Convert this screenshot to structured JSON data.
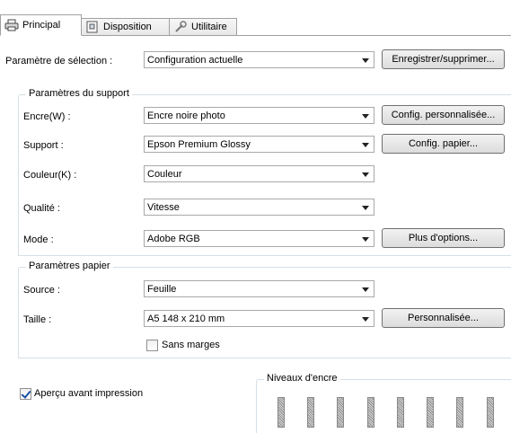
{
  "tabs": [
    {
      "label": "Principal",
      "icon": "printer-icon",
      "active": true
    },
    {
      "label": "Disposition",
      "icon": "page-layout-icon",
      "active": false
    },
    {
      "label": "Utilitaire",
      "icon": "wrench-icon",
      "active": false
    }
  ],
  "selection": {
    "label": "Paramètre de sélection :",
    "value": "Configuration actuelle",
    "button": "Enregistrer/supprimer..."
  },
  "support": {
    "title": "Paramètres du support",
    "encre": {
      "label": "Encre(W) :",
      "value": "Encre noire photo",
      "button": "Config. personnalisée..."
    },
    "support": {
      "label": "Support :",
      "value": "Epson Premium Glossy",
      "button": "Config. papier..."
    },
    "couleur": {
      "label": "Couleur(K) :",
      "value": "Couleur"
    },
    "qualite": {
      "label": "Qualité :",
      "value": "Vitesse"
    },
    "mode": {
      "label": "Mode :",
      "value": "Adobe RGB",
      "button": "Plus d'options..."
    }
  },
  "papier": {
    "title": "Paramètres papier",
    "source": {
      "label": "Source :",
      "value": "Feuille"
    },
    "taille": {
      "label": "Taille :",
      "value": "A5 148 x 210 mm",
      "button": "Personnalisée..."
    },
    "sans_marges": {
      "label": "Sans marges",
      "checked": false
    }
  },
  "apercu": {
    "label": "Aperçu avant impression",
    "checked": true
  },
  "niveaux": {
    "title": "Niveaux d'encre",
    "cartridge_count": 8
  },
  "colors": {
    "accent": "#1c4fa5",
    "group_border": "#d5dfe5"
  }
}
